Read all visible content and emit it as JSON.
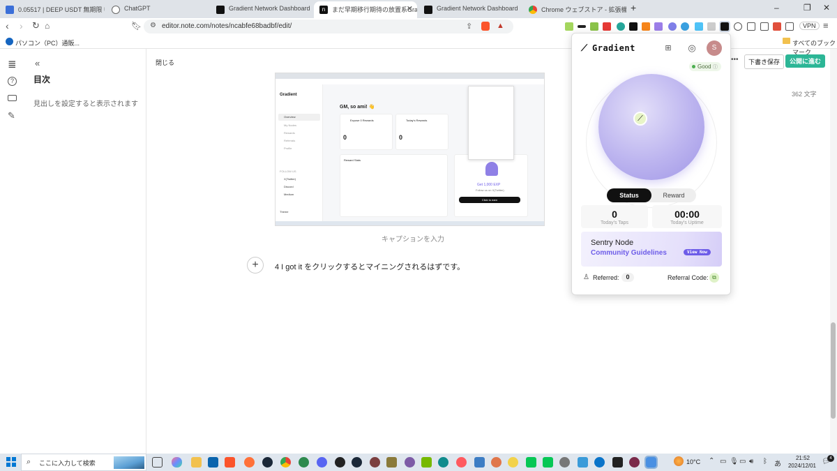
{
  "tabs": [
    {
      "title": "0.05517 | DEEP USDT 無期限 USDT-M"
    },
    {
      "title": "ChatGPT"
    },
    {
      "title": "Gradient Network Dashboard"
    },
    {
      "title": "まだ早期移行期待の放置系Gradient"
    },
    {
      "title": "Gradient Network Dashboard"
    },
    {
      "title": "Chrome ウェブストア - 拡張機能"
    }
  ],
  "new_tab": "+",
  "window_controls": {
    "minimize": "–",
    "maximize": "❐",
    "close": "✕"
  },
  "address_bar": {
    "url": "editor.note.com/notes/ncabfe68badbf/edit/"
  },
  "vpn_label": "VPN",
  "bookmarks": {
    "left": "パソコン（PC）通販...",
    "right": "すべてのブックマーク"
  },
  "sidebar": {
    "collapse": "«",
    "toc_title": "目次",
    "toc_empty": "見出しを設定すると表示されます"
  },
  "editor": {
    "close_label": "閉じる",
    "more": "•••",
    "save_draft": "下書き保存",
    "publish": "公開に進む",
    "char_count": "362 文字",
    "caption_placeholder": "キャプションを入力",
    "add_block": "+",
    "paragraph": "4  I got it をクリックするとマイニングされるはずです。"
  },
  "embedded_screenshot": {
    "brand": "Gradient",
    "greeting": "GM, so ami! 👋",
    "menu": [
      "Overview",
      "My Nodes",
      "Rewards",
      "Referrals",
      "Profile"
    ],
    "follow_us": "FOLLOW US",
    "socials": [
      "X(Twitter)",
      "Discord",
      "Medium"
    ],
    "expose_title": "Expose 0 Rewards",
    "expose_value": "0",
    "today_title": "Today's Rewards",
    "today_value": "0",
    "reward_stats": "Reward Stats",
    "exp_title": "Get 1,000 EXP",
    "exp_sub": "Follow us on X(Twitter)",
    "exp_btn": "Click to earn",
    "theme": "Theme"
  },
  "popup": {
    "brand": "Gradient",
    "avatar_letter": "S",
    "status_pill": "Good",
    "tabs": {
      "status": "Status",
      "reward": "Reward"
    },
    "taps_value": "0",
    "taps_label": "Today's Taps",
    "uptime_value": "00:00",
    "uptime_label": "Today's Uptime",
    "banner_title": "Sentry Node",
    "banner_subtitle": "Community Guidelines",
    "banner_btn": "View Now",
    "referred_label": "Referred:",
    "referred_value": "0",
    "referral_label": "Referral Code:"
  },
  "taskbar": {
    "search_placeholder": "ここに入力して検索",
    "temperature": "10°C",
    "ime": "あ",
    "time": "21:52",
    "date": "2024/12/01",
    "notif_count": "4"
  },
  "colors": {
    "publish_green": "#2cb696",
    "popup_orb": "#bcb4ef",
    "banner_purple": "#6d5ce8",
    "good_green": "#4caf50"
  }
}
